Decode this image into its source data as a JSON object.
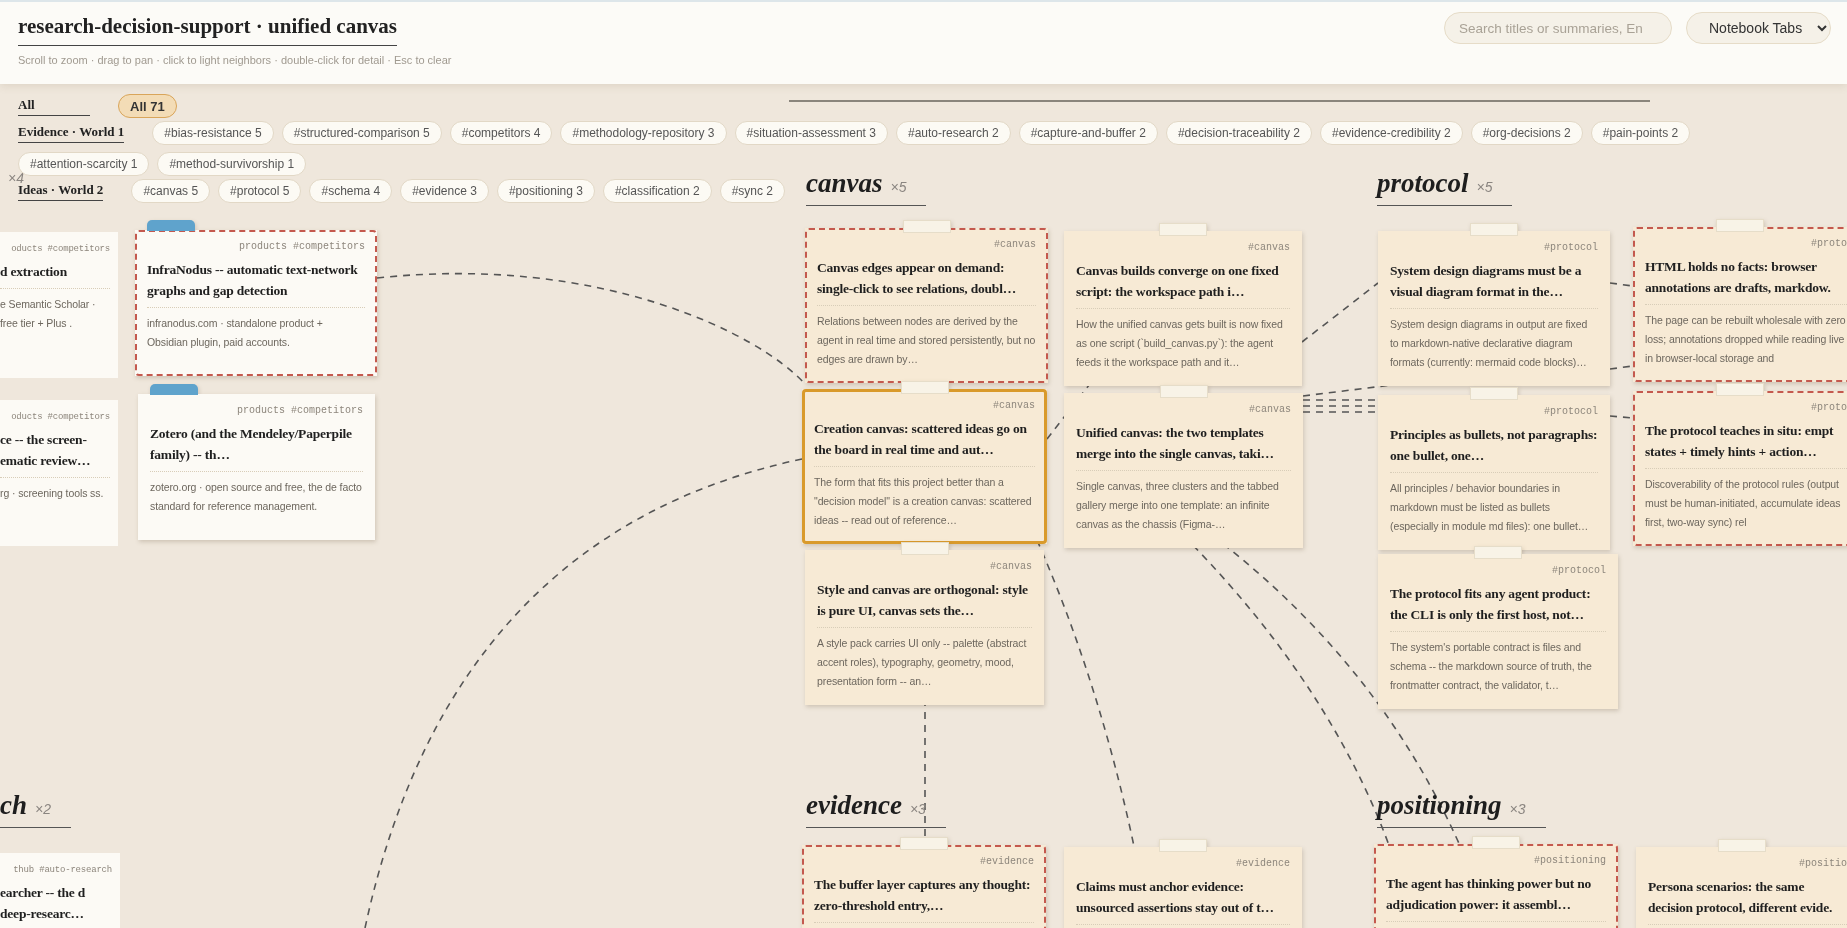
{
  "header": {
    "title": "research-decision-support · unified canvas",
    "hint": "Scroll to zoom · drag to pan · click to light neighbors · double-click for detail · Esc to clear",
    "search": {
      "placeholder": "Search titles or summaries, En"
    },
    "view": "Notebook Tabs"
  },
  "filters": [
    {
      "label": "All",
      "chips": [
        {
          "label": "All 71",
          "selected": true
        }
      ]
    },
    {
      "label": "Evidence · World 1",
      "chips": [
        {
          "label": "#bias-resistance 5",
          "selected": false
        },
        {
          "label": "#structured-comparison 5",
          "selected": false
        },
        {
          "label": "#competitors 4",
          "selected": false
        },
        {
          "label": "#methodology-repository 3",
          "selected": false
        },
        {
          "label": "#situation-assessment 3",
          "selected": false
        },
        {
          "label": "#auto-research 2",
          "selected": false
        },
        {
          "label": "#capture-and-buffer 2",
          "selected": false
        },
        {
          "label": "#decision-traceability 2",
          "selected": false
        },
        {
          "label": "#evidence-credibility 2",
          "selected": false
        },
        {
          "label": "#org-decisions 2",
          "selected": false
        },
        {
          "label": "#pain-points 2",
          "selected": false
        },
        {
          "label": "#attention-scarcity 1",
          "selected": false
        },
        {
          "label": "#method-survivorship 1",
          "selected": false
        }
      ]
    },
    {
      "label": "Ideas · World 2",
      "chips": [
        {
          "label": "#canvas 5",
          "selected": false
        },
        {
          "label": "#protocol 5",
          "selected": false
        },
        {
          "label": "#schema 4",
          "selected": false
        },
        {
          "label": "#evidence 3",
          "selected": false
        },
        {
          "label": "#positioning 3",
          "selected": false
        },
        {
          "label": "#classification 2",
          "selected": false
        },
        {
          "label": "#sync 2",
          "selected": false
        }
      ]
    }
  ],
  "clusters": [
    {
      "count": "×4",
      "cards": [
        {
          "kind": "evidence",
          "pinned": false,
          "flagged": false,
          "selected": false,
          "tags": "oducts #competitors",
          "title": "d extraction",
          "summary": "e Semantic Scholar · free tier + Plus ."
        },
        {
          "kind": "evidence",
          "pinned": false,
          "flagged": false,
          "selected": false,
          "tags": "oducts #competitors",
          "title": "ce -- the screen- ematic review…",
          "summary": "rg · screening tools ss."
        },
        {
          "kind": "evidence",
          "pinned": true,
          "flagged": true,
          "selected": false,
          "tags": "products #competitors",
          "title": "InfraNodus -- automatic text-network graphs and gap detection",
          "summary": "infranodus.com · standalone product + Obsidian plugin, paid accounts."
        },
        {
          "kind": "evidence",
          "pinned": true,
          "flagged": false,
          "selected": false,
          "tags": "products #competitors",
          "title": "Zotero (and the Mendeley/Paperpile family) -- th…",
          "summary": "zotero.org · open source and free, the de facto standard for reference management."
        }
      ]
    },
    {
      "name": "canvas",
      "count": "×5",
      "cards": [
        {
          "kind": "idea",
          "pinned": false,
          "flagged": true,
          "selected": false,
          "tags": "#canvas",
          "title": "Canvas edges appear on demand: single-click to see relations, doubl…",
          "summary": "Relations between nodes are derived by the agent in real time and stored persistently, but no edges are drawn by…"
        },
        {
          "kind": "idea",
          "pinned": false,
          "flagged": false,
          "selected": false,
          "tags": "#canvas",
          "title": "Canvas builds converge on one fixed script: the workspace path i…",
          "summary": "How the unified canvas gets built is now fixed as one script (`build_canvas.py`): the agent feeds it the workspace path and it…"
        },
        {
          "kind": "idea",
          "pinned": false,
          "flagged": false,
          "selected": true,
          "tags": "#canvas",
          "title": "Creation canvas: scattered ideas go on the board in real time and aut…",
          "summary": "The form that fits this project better than a \"decision model\" is a creation canvas: scattered ideas -- read out of reference…"
        },
        {
          "kind": "idea",
          "pinned": false,
          "flagged": false,
          "selected": false,
          "tags": "#canvas",
          "title": "Unified canvas: the two templates merge into the single canvas, taki…",
          "summary": "Single canvas, three clusters and the tabbed gallery merge into one template: an infinite canvas as the chassis (Figma-…"
        },
        {
          "kind": "idea",
          "pinned": false,
          "flagged": false,
          "selected": false,
          "tags": "#canvas",
          "title": "Style and canvas are orthogonal: style is pure UI, canvas sets the…",
          "summary": "A style pack carries UI only -- palette (abstract accent roles), typography, geometry, mood, presentation form -- an…"
        }
      ]
    },
    {
      "name": "protocol",
      "count": "×5",
      "cards": [
        {
          "kind": "idea",
          "pinned": false,
          "flagged": false,
          "selected": false,
          "tags": "#protocol",
          "title": "System design diagrams must be a visual diagram format in the…",
          "summary": "System design diagrams in output are fixed to markdown-native declarative diagram formats (currently: mermaid code blocks)…"
        },
        {
          "kind": "idea",
          "pinned": false,
          "flagged": true,
          "selected": false,
          "tags": "#proto",
          "title": "HTML holds no facts: browser annotations are drafts, markdow.",
          "summary": "The page can be rebuilt wholesale with zero loss; annotations dropped while reading live in browser-local storage and"
        },
        {
          "kind": "idea",
          "pinned": false,
          "flagged": false,
          "selected": false,
          "tags": "#protocol",
          "title": "Principles as bullets, not paragraphs: one bullet, one…",
          "summary": "All principles / behavior boundaries in markdown must be listed as bullets (especially in module md files): one bullet…"
        },
        {
          "kind": "idea",
          "pinned": false,
          "flagged": true,
          "selected": false,
          "tags": "#proto",
          "title": "The protocol teaches in situ: empt states + timely hints + action…",
          "summary": "Discoverability of the protocol rules (output must be human-initiated, accumulate ideas first, two-way sync) rel"
        },
        {
          "kind": "idea",
          "pinned": false,
          "flagged": false,
          "selected": false,
          "tags": "#protocol",
          "title": "The protocol fits any agent product: the CLI is only the first host, not…",
          "summary": "The system's portable contract is files and schema -- the markdown source of truth, the frontmatter contract, the validator, t…"
        }
      ]
    },
    {
      "name": "ch",
      "count": "×2",
      "cards": [
        {
          "kind": "evidence",
          "pinned": false,
          "flagged": false,
          "selected": false,
          "tags": "thub #auto-research",
          "title": "earcher -- the d deep-researc…"
        }
      ]
    },
    {
      "name": "evidence",
      "count": "×3",
      "cards": [
        {
          "kind": "idea",
          "pinned": false,
          "flagged": true,
          "selected": false,
          "tags": "#evidence",
          "title": "The buffer layer captures any thought: zero-threshold entry,…"
        },
        {
          "kind": "idea",
          "pinned": false,
          "flagged": false,
          "selected": false,
          "tags": "#evidence",
          "title": "Claims must anchor evidence: unsourced assertions stay out of t…"
        }
      ]
    },
    {
      "name": "positioning",
      "count": "×3",
      "cards": [
        {
          "kind": "idea",
          "pinned": false,
          "flagged": true,
          "selected": false,
          "tags": "#positioning",
          "title": "The agent has thinking power but no adjudication power: it assembl…"
        },
        {
          "kind": "idea",
          "pinned": false,
          "flagged": false,
          "selected": false,
          "tags": "#positio",
          "title": "Persona scenarios: the same decision protocol, different evide."
        }
      ]
    }
  ]
}
